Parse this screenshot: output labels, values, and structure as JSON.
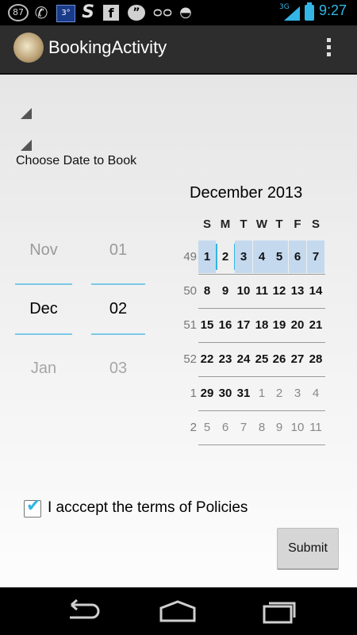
{
  "status_bar": {
    "badge_count": "87",
    "temperature": "3°",
    "network": "3G",
    "time": "9:27",
    "icons": [
      "notification-count-icon",
      "whatsapp-icon",
      "weather-icon",
      "s-app-icon",
      "facebook-icon",
      "hangouts-icon",
      "voicemail-icon",
      "android-icon",
      "signal-icon",
      "battery-icon"
    ]
  },
  "action_bar": {
    "title": "BookingActivity",
    "icons": [
      "app-icon",
      "overflow-menu-icon"
    ]
  },
  "form": {
    "choose_label": "Choose Date to Book",
    "month_picker": {
      "prev": "Nov",
      "current": "Dec",
      "next": "Jan"
    },
    "day_picker": {
      "prev": "01",
      "current": "02",
      "next": "03"
    },
    "calendar": {
      "title": "December 2013",
      "weekdays": [
        "S",
        "M",
        "T",
        "W",
        "T",
        "F",
        "S"
      ],
      "weeks": [
        {
          "num": "49",
          "days": [
            "1",
            "2",
            "3",
            "4",
            "5",
            "6",
            "7"
          ]
        },
        {
          "num": "50",
          "days": [
            "8",
            "9",
            "10",
            "11",
            "12",
            "13",
            "14"
          ]
        },
        {
          "num": "51",
          "days": [
            "15",
            "16",
            "17",
            "18",
            "19",
            "20",
            "21"
          ]
        },
        {
          "num": "52",
          "days": [
            "22",
            "23",
            "24",
            "25",
            "26",
            "27",
            "28"
          ]
        },
        {
          "num": "1",
          "days": [
            "29",
            "30",
            "31",
            "1",
            "2",
            "3",
            "4"
          ]
        },
        {
          "num": "2",
          "days": [
            "5",
            "6",
            "7",
            "8",
            "9",
            "10",
            "11"
          ]
        }
      ]
    },
    "terms_label": "I acccept the terms of Policies",
    "terms_checked": true,
    "submit_label": "Submit"
  },
  "colors": {
    "accent": "#33b5e5",
    "selected_week": "#c4d9ee",
    "action_bar": "#2d2d2d"
  }
}
